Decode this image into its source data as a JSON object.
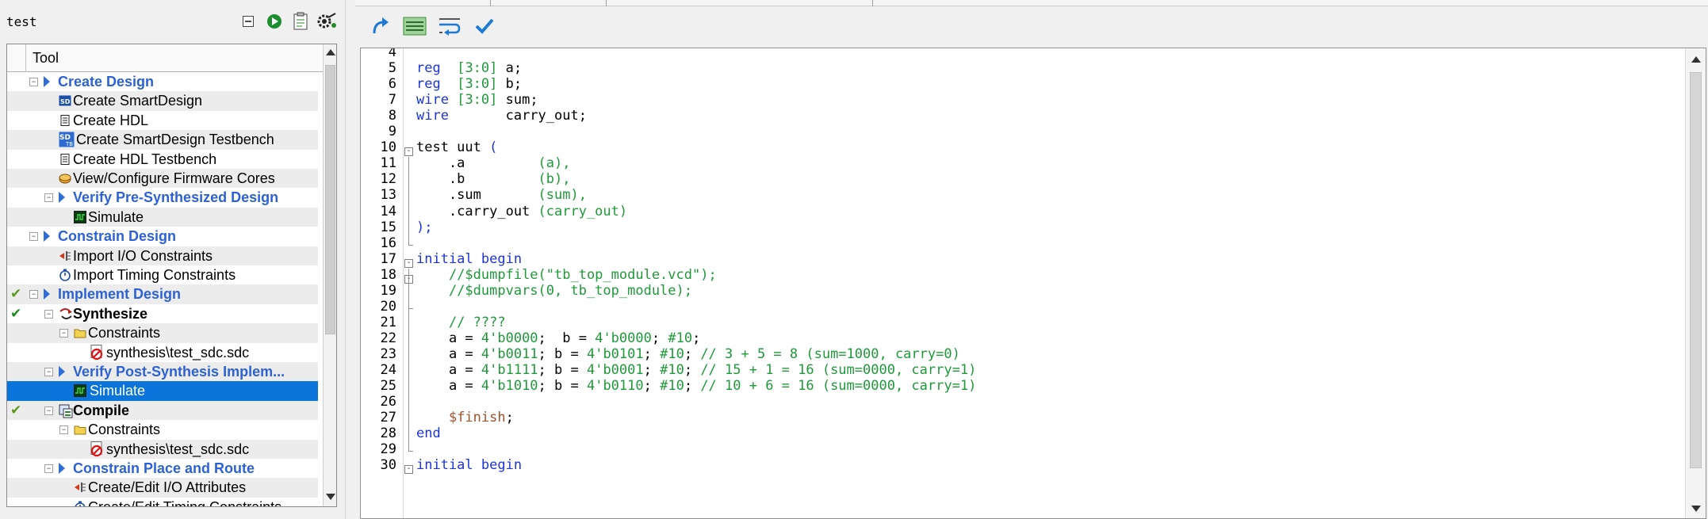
{
  "project": {
    "title": "test"
  },
  "left_toolbar": [
    {
      "name": "collapse-all-icon",
      "glyph": "⊟"
    },
    {
      "name": "run-icon",
      "glyph": "▶"
    },
    {
      "name": "report-icon",
      "glyph": "📋"
    },
    {
      "name": "configure-icon",
      "glyph": "⚙"
    }
  ],
  "tool_panel": {
    "header": "Tool"
  },
  "tree": [
    {
      "label": "Create Design",
      "level": 1,
      "style": "cat",
      "expander": "⊟",
      "arrow": true,
      "icon": "",
      "check": ""
    },
    {
      "label": "Create SmartDesign",
      "level": 2,
      "style": "normal",
      "expander": "",
      "arrow": false,
      "icon": "smartdesign-icon",
      "check": ""
    },
    {
      "label": "Create HDL",
      "level": 2,
      "style": "normal",
      "expander": "",
      "arrow": false,
      "icon": "hdl-file-icon",
      "check": ""
    },
    {
      "label": "Create SmartDesign Testbench",
      "level": 2,
      "style": "normal",
      "expander": "",
      "arrow": false,
      "icon": "smartdesign-testbench-icon",
      "check": ""
    },
    {
      "label": "Create HDL Testbench",
      "level": 2,
      "style": "normal",
      "expander": "",
      "arrow": false,
      "icon": "hdl-file-icon",
      "check": ""
    },
    {
      "label": "View/Configure Firmware Cores",
      "level": 2,
      "style": "normal",
      "expander": "",
      "arrow": false,
      "icon": "firmware-icon",
      "check": ""
    },
    {
      "label": "Verify Pre-Synthesized Design",
      "level": 2,
      "style": "cat",
      "expander": "⊟",
      "arrow": true,
      "icon": "",
      "check": ""
    },
    {
      "label": "Simulate",
      "level": 3,
      "style": "normal",
      "expander": "",
      "arrow": false,
      "icon": "simulate-icon",
      "check": ""
    },
    {
      "label": "Constrain Design",
      "level": 1,
      "style": "cat",
      "expander": "⊟",
      "arrow": true,
      "icon": "",
      "check": ""
    },
    {
      "label": "Import I/O Constraints",
      "level": 2,
      "style": "normal",
      "expander": "",
      "arrow": false,
      "icon": "import-io-icon",
      "check": ""
    },
    {
      "label": "Import Timing Constraints",
      "level": 2,
      "style": "normal",
      "expander": "",
      "arrow": false,
      "icon": "timing-icon",
      "check": ""
    },
    {
      "label": "Implement Design",
      "level": 1,
      "style": "cat",
      "expander": "⊟",
      "arrow": true,
      "icon": "",
      "check": "warn"
    },
    {
      "label": "Synthesize",
      "level": 2,
      "style": "bold",
      "expander": "⊟",
      "arrow": false,
      "icon": "synthesize-icon",
      "check": "ok"
    },
    {
      "label": "Constraints",
      "level": 3,
      "style": "normal",
      "expander": "⊟",
      "arrow": false,
      "icon": "folder-icon",
      "check": ""
    },
    {
      "label": "synthesis\\test_sdc.sdc",
      "level": 4,
      "style": "normal",
      "expander": "",
      "arrow": false,
      "icon": "sdc-file-icon",
      "check": ""
    },
    {
      "label": "Verify Post-Synthesis Implem...",
      "level": 2,
      "style": "cat",
      "expander": "⊟",
      "arrow": true,
      "icon": "",
      "check": ""
    },
    {
      "label": "Simulate",
      "level": 3,
      "style": "normal",
      "expander": "",
      "arrow": false,
      "icon": "simulate-icon",
      "check": "",
      "selected": true
    },
    {
      "label": "Compile",
      "level": 2,
      "style": "bold",
      "expander": "⊟",
      "arrow": false,
      "icon": "compile-icon",
      "check": "warn"
    },
    {
      "label": "Constraints",
      "level": 3,
      "style": "normal",
      "expander": "⊟",
      "arrow": false,
      "icon": "folder-icon",
      "check": ""
    },
    {
      "label": "synthesis\\test_sdc.sdc",
      "level": 4,
      "style": "normal",
      "expander": "",
      "arrow": false,
      "icon": "sdc-file-icon",
      "check": ""
    },
    {
      "label": "Constrain Place and Route",
      "level": 2,
      "style": "cat",
      "expander": "⊟",
      "arrow": true,
      "icon": "",
      "check": ""
    },
    {
      "label": "Create/Edit I/O Attributes",
      "level": 3,
      "style": "normal",
      "expander": "",
      "arrow": false,
      "icon": "import-io-icon",
      "check": ""
    },
    {
      "label": "Create/Edit Timing Constraints",
      "level": 3,
      "style": "normal",
      "expander": "",
      "arrow": false,
      "icon": "timing-icon",
      "check": ""
    }
  ],
  "editor_toolbar": [
    {
      "name": "redo-icon"
    },
    {
      "name": "comment-block-icon"
    },
    {
      "name": "wrap-icon"
    },
    {
      "name": "check-syntax-icon"
    }
  ],
  "code_lines": [
    {
      "n": "4",
      "fold": "",
      "spans": []
    },
    {
      "n": "5",
      "fold": "",
      "spans": [
        [
          "kw",
          "reg"
        ],
        [
          "",
          "  "
        ],
        [
          "nu",
          "[3:0]"
        ],
        [
          "",
          " a;"
        ]
      ]
    },
    {
      "n": "6",
      "fold": "",
      "spans": [
        [
          "kw",
          "reg"
        ],
        [
          "",
          "  "
        ],
        [
          "nu",
          "[3:0]"
        ],
        [
          "",
          " b;"
        ]
      ]
    },
    {
      "n": "7",
      "fold": "",
      "spans": [
        [
          "kw",
          "wire"
        ],
        [
          "",
          " "
        ],
        [
          "nu",
          "[3:0]"
        ],
        [
          "",
          " sum;"
        ]
      ]
    },
    {
      "n": "8",
      "fold": "",
      "spans": [
        [
          "kw",
          "wire"
        ],
        [
          "",
          "       carry_out;"
        ]
      ]
    },
    {
      "n": "9",
      "fold": "",
      "spans": []
    },
    {
      "n": "10",
      "fold": "open",
      "spans": [
        [
          "",
          "test uut "
        ],
        [
          "kw",
          "("
        ]
      ]
    },
    {
      "n": "11",
      "fold": "",
      "spans": [
        [
          "",
          "    .a         "
        ],
        [
          "nu",
          "(a),"
        ]
      ]
    },
    {
      "n": "12",
      "fold": "",
      "spans": [
        [
          "",
          "    .b         "
        ],
        [
          "nu",
          "(b),"
        ]
      ]
    },
    {
      "n": "13",
      "fold": "",
      "spans": [
        [
          "",
          "    .sum       "
        ],
        [
          "nu",
          "(sum),"
        ]
      ]
    },
    {
      "n": "14",
      "fold": "",
      "spans": [
        [
          "",
          "    .carry_out "
        ],
        [
          "nu",
          "(carry_out)"
        ]
      ]
    },
    {
      "n": "15",
      "fold": "",
      "spans": [
        [
          "kw",
          ");"
        ]
      ]
    },
    {
      "n": "16",
      "fold": "end",
      "spans": []
    },
    {
      "n": "17",
      "fold": "open",
      "spans": [
        [
          "kw",
          "initial begin"
        ]
      ]
    },
    {
      "n": "18",
      "fold": "open",
      "spans": [
        [
          "",
          "    "
        ],
        [
          "cm",
          "//$dumpfile(\"tb_top_module.vcd\");"
        ]
      ]
    },
    {
      "n": "19",
      "fold": "",
      "spans": [
        [
          "",
          "    "
        ],
        [
          "cm",
          "//$dumpvars(0, tb_top_module);"
        ]
      ]
    },
    {
      "n": "20",
      "fold": "end",
      "spans": []
    },
    {
      "n": "21",
      "fold": "",
      "spans": [
        [
          "",
          "    "
        ],
        [
          "cm",
          "// ????"
        ]
      ]
    },
    {
      "n": "22",
      "fold": "",
      "spans": [
        [
          "",
          "    a = "
        ],
        [
          "nu",
          "4'b0000"
        ],
        [
          "",
          ";  b = "
        ],
        [
          "nu",
          "4'b0000"
        ],
        [
          "",
          "; "
        ],
        [
          "nu",
          "#10"
        ],
        [
          "",
          ";"
        ]
      ]
    },
    {
      "n": "23",
      "fold": "",
      "spans": [
        [
          "",
          "    a = "
        ],
        [
          "nu",
          "4'b0011"
        ],
        [
          "",
          "; b = "
        ],
        [
          "nu",
          "4'b0101"
        ],
        [
          "",
          "; "
        ],
        [
          "nu",
          "#10"
        ],
        [
          "",
          "; "
        ],
        [
          "cm",
          "// 3 + 5 = 8 (sum=1000, carry=0)"
        ]
      ]
    },
    {
      "n": "24",
      "fold": "",
      "spans": [
        [
          "",
          "    a = "
        ],
        [
          "nu",
          "4'b1111"
        ],
        [
          "",
          "; b = "
        ],
        [
          "nu",
          "4'b0001"
        ],
        [
          "",
          "; "
        ],
        [
          "nu",
          "#10"
        ],
        [
          "",
          "; "
        ],
        [
          "cm",
          "// 15 + 1 = 16 (sum=0000, carry=1)"
        ]
      ]
    },
    {
      "n": "25",
      "fold": "",
      "spans": [
        [
          "",
          "    a = "
        ],
        [
          "nu",
          "4'b1010"
        ],
        [
          "",
          "; b = "
        ],
        [
          "nu",
          "4'b0110"
        ],
        [
          "",
          "; "
        ],
        [
          "nu",
          "#10"
        ],
        [
          "",
          "; "
        ],
        [
          "cm",
          "// 10 + 6 = 16 (sum=0000, carry=1)"
        ]
      ]
    },
    {
      "n": "26",
      "fold": "",
      "spans": []
    },
    {
      "n": "27",
      "fold": "",
      "spans": [
        [
          "",
          "    "
        ],
        [
          "sy",
          "$finish"
        ],
        [
          "",
          ";"
        ]
      ]
    },
    {
      "n": "28",
      "fold": "",
      "spans": [
        [
          "kw",
          "end"
        ]
      ]
    },
    {
      "n": "29",
      "fold": "end",
      "spans": []
    },
    {
      "n": "30",
      "fold": "open",
      "spans": [
        [
          "kw",
          "initial begin"
        ]
      ]
    }
  ],
  "colors": {
    "selection": "#0a74da",
    "category": "#2d62d6",
    "keyword": "#1c34d8",
    "comment": "#1f9a3a"
  }
}
